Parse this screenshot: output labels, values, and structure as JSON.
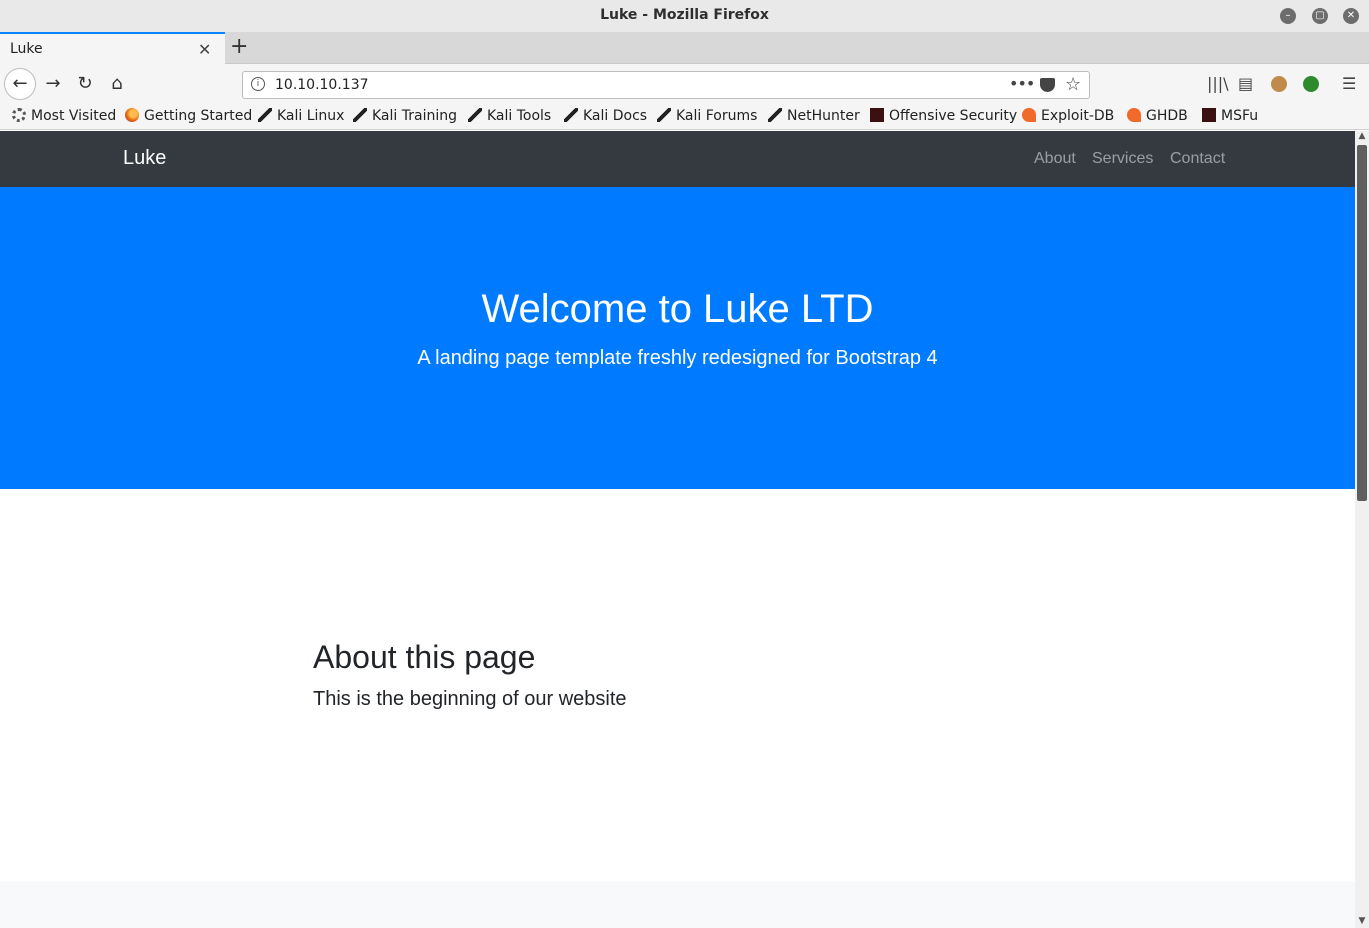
{
  "window": {
    "title": "Luke - Mozilla Firefox"
  },
  "tab": {
    "label": "Luke",
    "close": "✕",
    "new_tab": "+"
  },
  "nav_buttons": {
    "back": "←",
    "forward": "→",
    "reload": "↻",
    "home": "⌂"
  },
  "urlbar": {
    "info": "i",
    "url": "10.10.10.137",
    "more": "•••",
    "star": "☆"
  },
  "toolbar_right": {
    "library": "|||\\",
    "sidebar": "▤",
    "menu": "☰"
  },
  "bookmarks": [
    {
      "label": "Most Visited",
      "icon": "gear-icon"
    },
    {
      "label": "Getting Started",
      "icon": "firefox-icon"
    },
    {
      "label": "Kali Linux",
      "icon": "kali-icon"
    },
    {
      "label": "Kali Training",
      "icon": "kali-icon"
    },
    {
      "label": "Kali Tools",
      "icon": "kali-icon"
    },
    {
      "label": "Kali Docs",
      "icon": "kali-icon"
    },
    {
      "label": "Kali Forums",
      "icon": "kali-icon"
    },
    {
      "label": "NetHunter",
      "icon": "kali-icon"
    },
    {
      "label": "Offensive Security",
      "icon": "offsec-icon"
    },
    {
      "label": "Exploit-DB",
      "icon": "exploitdb-icon"
    },
    {
      "label": "GHDB",
      "icon": "exploitdb-icon"
    },
    {
      "label": "MSFu",
      "icon": "offsec-icon"
    }
  ],
  "site": {
    "brand": "Luke",
    "nav": {
      "about": "About",
      "services": "Services",
      "contact": "Contact"
    },
    "hero": {
      "title": "Welcome to Luke LTD",
      "subtitle": "A landing page template freshly redesigned for Bootstrap 4",
      "background": "#007bff"
    },
    "about": {
      "heading": "About this page",
      "text": "This is the beginning of our website"
    }
  },
  "colors": {
    "navbar": "#343a40",
    "accent": "#0a84ff"
  }
}
